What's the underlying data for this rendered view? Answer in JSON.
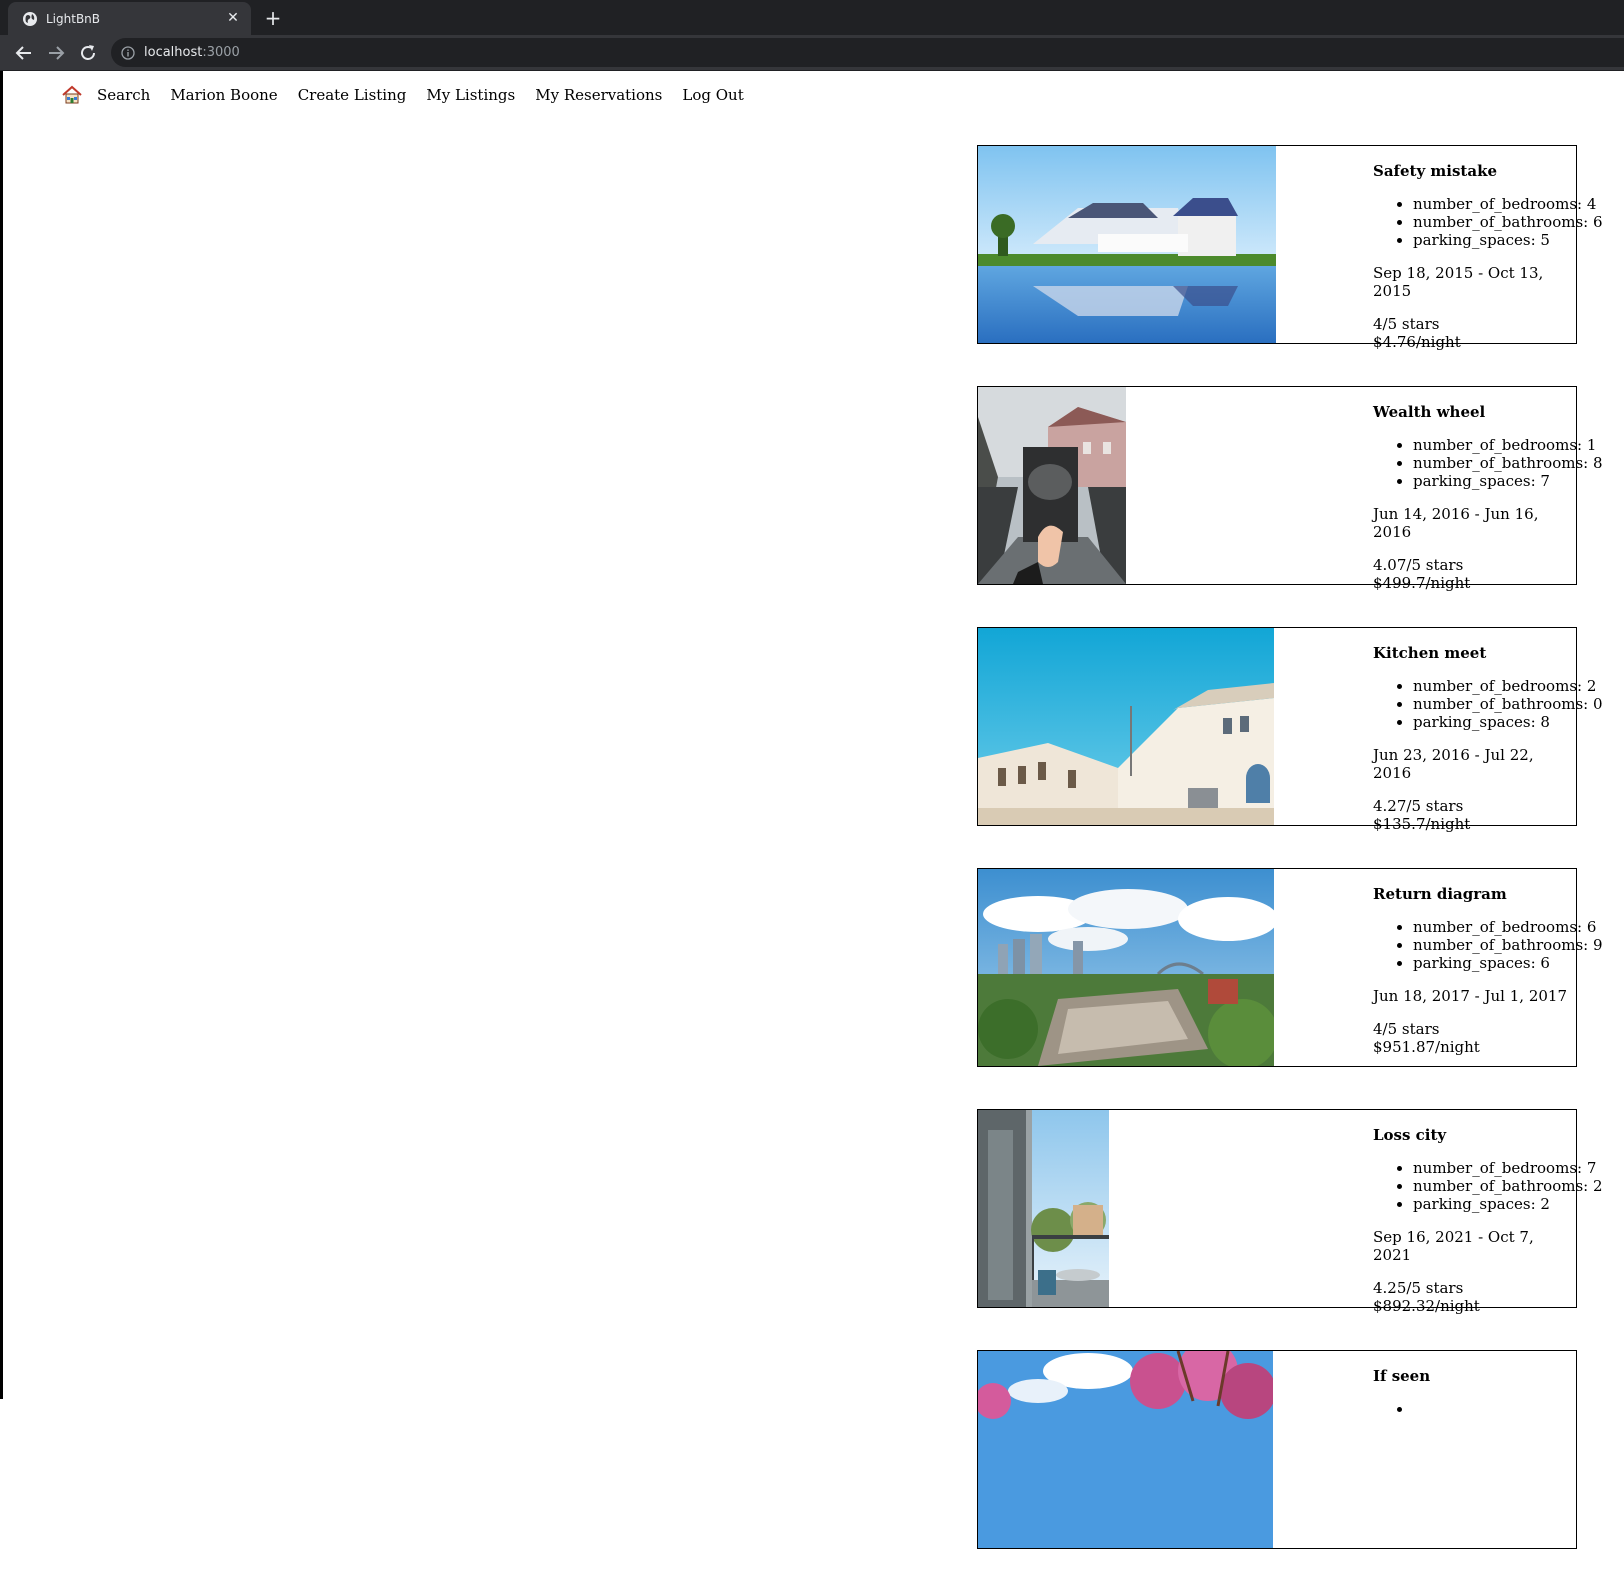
{
  "browser": {
    "tab_title": "LightBnB",
    "url_host": "localhost",
    "url_port": ":3000"
  },
  "nav": {
    "items": [
      "Search",
      "Marion Boone",
      "Create Listing",
      "My Listings",
      "My Reservations",
      "Log Out"
    ]
  },
  "listings": [
    {
      "title": "Safety mistake",
      "bedrooms": "number_of_bedrooms: 4",
      "bathrooms": "number_of_bathrooms: 6",
      "parking": "parking_spaces: 5",
      "dates": "Sep 18, 2015 - Oct 13, 2015",
      "rating": "4/5 stars",
      "price": "$4.76/night"
    },
    {
      "title": "Wealth wheel",
      "bedrooms": "number_of_bedrooms: 1",
      "bathrooms": "number_of_bathrooms: 8",
      "parking": "parking_spaces: 7",
      "dates": "Jun 14, 2016 - Jun 16, 2016",
      "rating": "4.07/5 stars",
      "price": "$499.7/night"
    },
    {
      "title": "Kitchen meet",
      "bedrooms": "number_of_bedrooms: 2",
      "bathrooms": "number_of_bathrooms: 0",
      "parking": "parking_spaces: 8",
      "dates": "Jun 23, 2016 - Jul 22, 2016",
      "rating": "4.27/5 stars",
      "price": "$135.7/night"
    },
    {
      "title": "Return diagram",
      "bedrooms": "number_of_bedrooms: 6",
      "bathrooms": "number_of_bathrooms: 9",
      "parking": "parking_spaces: 6",
      "dates": "Jun 18, 2017 - Jul 1, 2017",
      "rating": "4/5 stars",
      "price": "$951.87/night"
    },
    {
      "title": "Loss city",
      "bedrooms": "number_of_bedrooms: 7",
      "bathrooms": "number_of_bathrooms: 2",
      "parking": "parking_spaces: 2",
      "dates": "Sep 16, 2021 - Oct 7, 2021",
      "rating": "4.25/5 stars",
      "price": "$892.32/night"
    },
    {
      "title": "If seen",
      "bedrooms": "",
      "bathrooms": "",
      "parking": "",
      "dates": "",
      "rating": "",
      "price": ""
    }
  ]
}
